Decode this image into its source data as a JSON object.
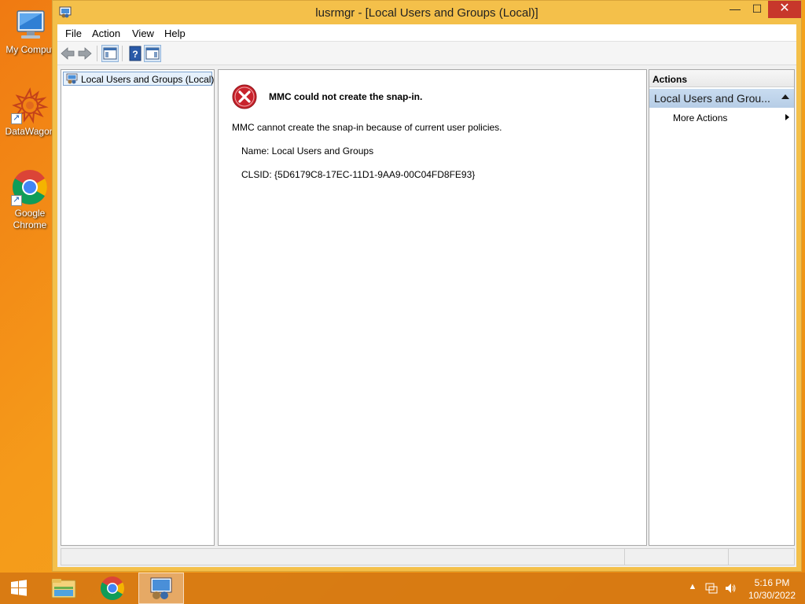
{
  "desktop": {
    "icons": [
      {
        "label": "My Comput",
        "icon": "computer-icon"
      },
      {
        "label": "DataWagon",
        "icon": "datawagon-icon"
      },
      {
        "label": "Google Chrome",
        "icon": "chrome-icon"
      }
    ]
  },
  "window": {
    "title": "lusrmgr - [Local Users and Groups (Local)]",
    "controls": {
      "minimize": "—",
      "maximize": "☐",
      "close": "✕"
    }
  },
  "menubar": {
    "items": [
      "File",
      "Action",
      "View",
      "Help"
    ]
  },
  "toolbar": {
    "buttons": [
      "back-arrow-icon",
      "forward-arrow-icon",
      "show-hide-console-tree-icon",
      "help-icon",
      "show-hide-action-pane-icon"
    ]
  },
  "tree": {
    "root_label": "Local Users and Groups (Local)"
  },
  "error": {
    "title": "MMC could not create the snap-in.",
    "description": "MMC cannot create the snap-in because of current user policies.",
    "name_line": "Name: Local Users and Groups",
    "clsid_line": "CLSID: {5D6179C8-17EC-11D1-9AA9-00C04FD8FE93}"
  },
  "actions": {
    "header": "Actions",
    "group_label": "Local Users and Grou...",
    "more_actions": "More Actions"
  },
  "taskbar": {
    "apps": [
      "file-explorer-icon",
      "chrome-icon",
      "lusrmgr-icon"
    ],
    "active_app": "lusrmgr-icon",
    "tray": [
      "show-hidden-icons-icon",
      "network-icon",
      "volume-icon"
    ]
  },
  "clock": {
    "time": "5:16 PM",
    "date": "10/30/2022"
  },
  "colors": {
    "desktop_orange": "#f59a1a",
    "window_frame": "#f4c04a",
    "close_red": "#c7372b",
    "actions_group_blue": "#c9dcf0",
    "error_red": "#c8232c"
  }
}
